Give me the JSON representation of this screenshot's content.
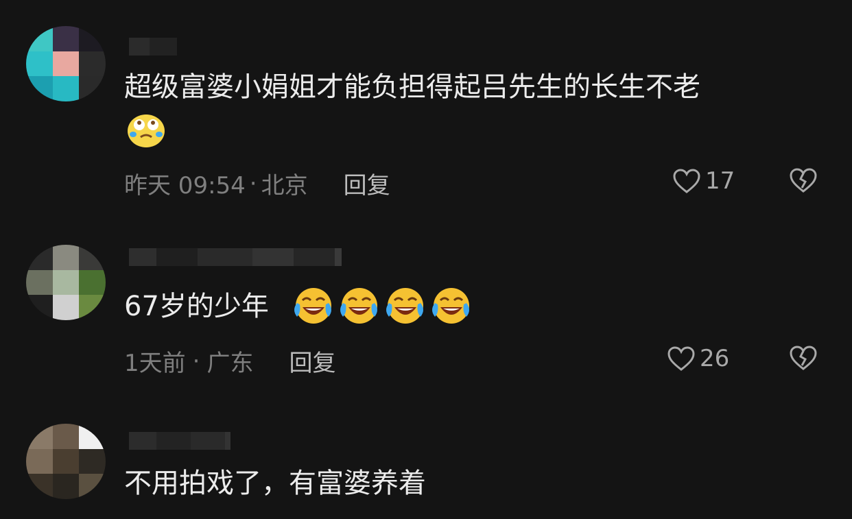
{
  "comments": [
    {
      "text": "超级富婆小娟姐才能负担得起吕先生的长生不老",
      "emojis": [
        "crying-laughing-face-icon"
      ],
      "time": "昨天 09:54",
      "location": "北京",
      "reply_label": "回复",
      "likes": "17"
    },
    {
      "text": "67岁的少年",
      "emojis": [
        "tears-of-joy-icon",
        "tears-of-joy-icon",
        "tears-of-joy-icon",
        "tears-of-joy-icon"
      ],
      "time": "1天前",
      "location": "广东",
      "reply_label": "回复",
      "likes": "26"
    },
    {
      "text": "不用拍戏了，有富婆养着"
    }
  ],
  "separator": "·"
}
